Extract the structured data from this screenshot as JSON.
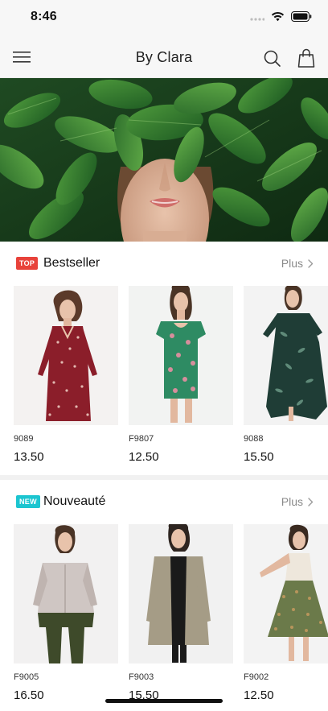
{
  "status_bar": {
    "time": "8:46"
  },
  "navbar": {
    "title": "By Clara",
    "icons": [
      "menu-icon",
      "search-icon",
      "shopping-bag-icon"
    ]
  },
  "hero": {
    "image": "woman-face-behind-green-leaves"
  },
  "sections": [
    {
      "badge": "TOP",
      "badge_color": "#e8423a",
      "title": "Bestseller",
      "more_label": "Plus",
      "products": [
        {
          "code": "9089",
          "price": "13.50",
          "image": "red-floral-long-sleeve-dress"
        },
        {
          "code": "F9807",
          "price": "12.50",
          "image": "green-floral-puff-sleeve-dress"
        },
        {
          "code": "9088",
          "price": "15.50",
          "image": "dark-green-leaf-print-maxi-dress"
        }
      ]
    },
    {
      "badge": "NEW",
      "badge_color": "#1cc5d0",
      "title": "Nouveauté",
      "more_label": "Plus",
      "products": [
        {
          "code": "F9005",
          "price": "16.50",
          "image": "silver-and-olive-jacket-outfit"
        },
        {
          "code": "F9003",
          "price": "15.50",
          "image": "beige-trench-coat"
        },
        {
          "code": "F9002",
          "price": "12.50",
          "image": "green-print-tiered-skirt"
        }
      ]
    }
  ]
}
